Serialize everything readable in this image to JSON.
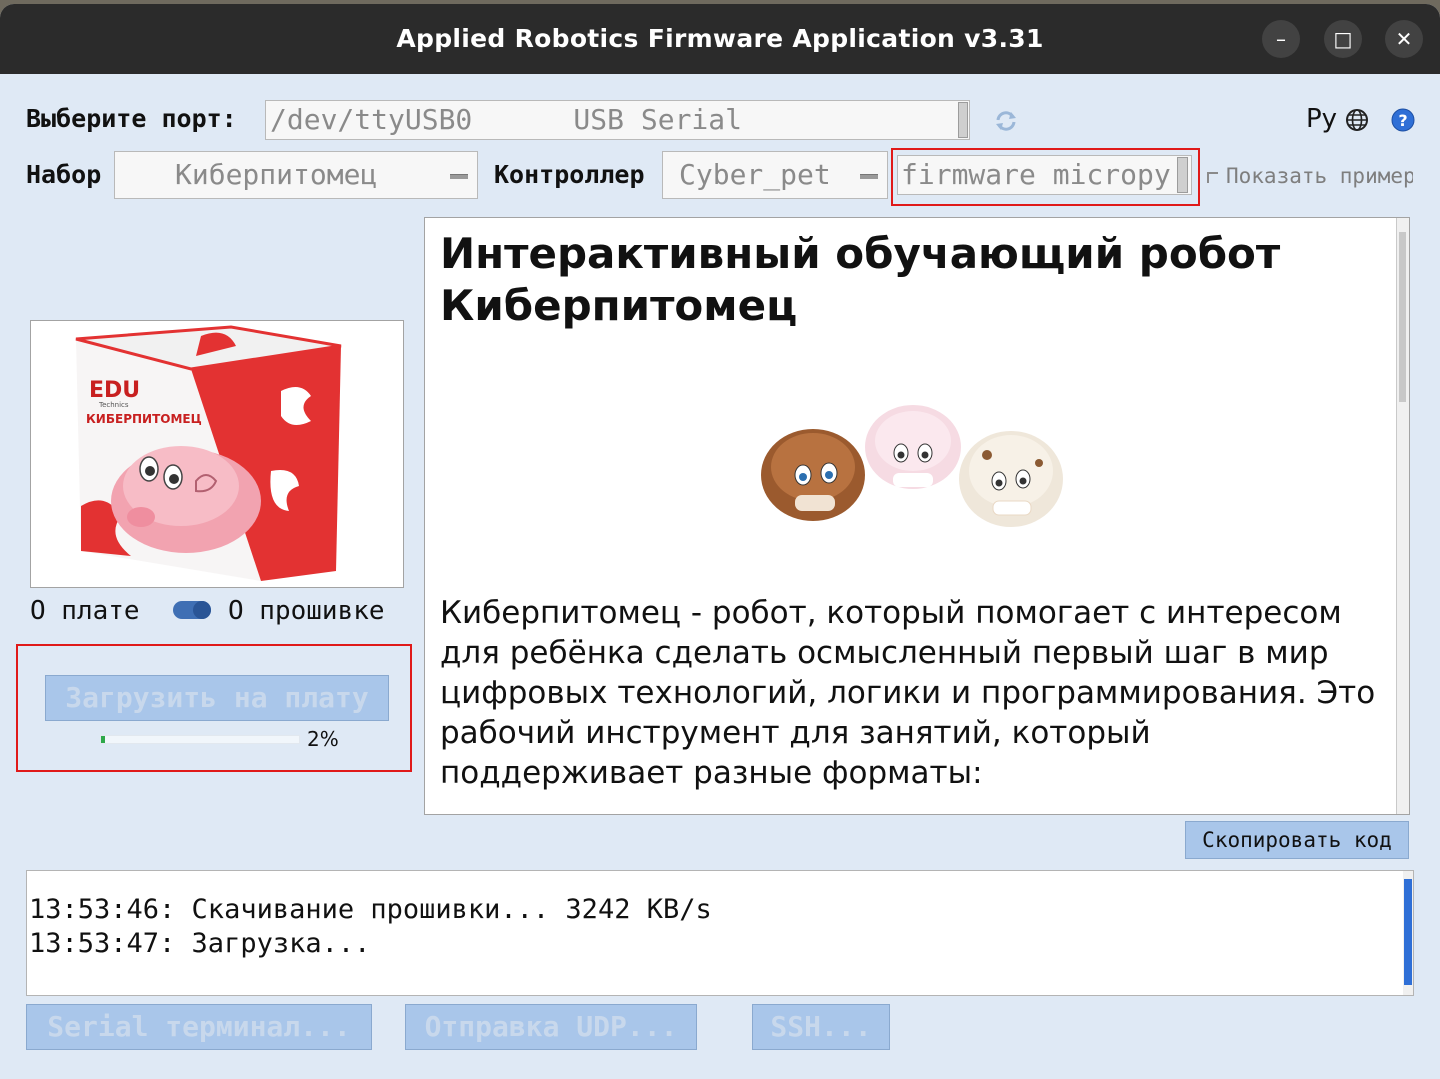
{
  "window": {
    "title": "Applied Robotics Firmware Application v3.31"
  },
  "titlebar_buttons": {
    "minimize": "–",
    "maximize": "□",
    "close": "✕"
  },
  "port": {
    "label": "Выберите порт:",
    "value": "/dev/ttyUSB0      USB Serial"
  },
  "language": {
    "label": "Ру"
  },
  "kit": {
    "label": "Набор",
    "value": "Киберпитомец"
  },
  "controller": {
    "label": "Контроллер",
    "value": "Cyber_pet"
  },
  "firmware": {
    "value": "firmware micropy"
  },
  "show_example": {
    "label": "Показать пример"
  },
  "description": {
    "title": "Интерактивный обучающий робот Киберпитомец",
    "text": "Киберпитомец - робот, который помогает с интересом для ребёнка сделать осмысленный первый шаг в мир цифровых технологий, логики и программирования. Это рабочий инструмент для занятий, который поддерживает разные форматы:"
  },
  "product": {
    "brand": "EDU",
    "brand_sub": "Technics",
    "box_name": "КИБЕРПИТОМЕЦ"
  },
  "toggle": {
    "left_label": "О плате",
    "right_label": "О прошивке"
  },
  "upload": {
    "button_label": "Загрузить на плату",
    "progress_label": "2%",
    "progress": 0.02
  },
  "copy_button": {
    "label": "Скопировать код"
  },
  "log": {
    "lines": [
      "13:53:46: Скачивание прошивки... 3242 KB/s",
      "13:53:47: Загрузка..."
    ]
  },
  "bottom_buttons": {
    "serial": "Serial терминал...",
    "udp": "Отправка UDP...",
    "ssh": "SSH..."
  },
  "colors": {
    "background": "#dfe9f5",
    "button": "#a9c6ea",
    "highlight": "#e01919",
    "progress": "#2ea84a"
  }
}
